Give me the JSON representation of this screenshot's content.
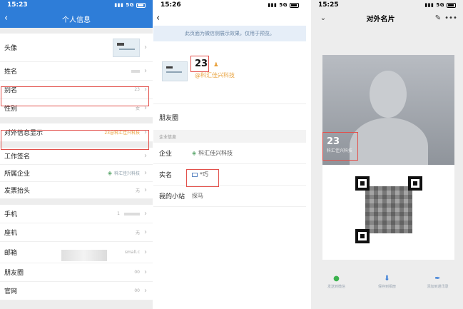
{
  "panel1": {
    "status": {
      "time": "15:23",
      "signal": "5G"
    },
    "nav": {
      "back_icon": "‹",
      "title": "个人信息"
    },
    "rows": {
      "avatar": {
        "label": "头像"
      },
      "name": {
        "label": "姓名",
        "value": ""
      },
      "alias": {
        "label": "别名",
        "value": "23"
      },
      "gender": {
        "label": "性别",
        "value": "女"
      },
      "external": {
        "label": "对外信息显示",
        "value": "23@科汇佳兴科技"
      },
      "job": {
        "label": "工作签名"
      },
      "corp": {
        "label": "所属企业",
        "value": "科汇佳兴科技"
      },
      "invoice": {
        "label": "发票抬头",
        "value": "无"
      },
      "mobile": {
        "label": "手机",
        "value": "1"
      },
      "phone": {
        "label": "座机",
        "value": "无"
      },
      "email": {
        "label": "邮箱",
        "value": "small.c"
      },
      "moments": {
        "label": "朋友圈",
        "value": "00"
      },
      "site": {
        "label": "官网",
        "value": "00"
      }
    }
  },
  "panel2": {
    "status": {
      "time": "15:26",
      "signal": "5G"
    },
    "back_icon": "‹",
    "notice": "此页面为微信侧展示效果，仅用于预览。",
    "name": "23",
    "corp_tag": "@科汇佳兴科技",
    "moments": "朋友圈",
    "section": "企业信息",
    "enterprise": {
      "label": "企业",
      "value": "科汇佳兴科技"
    },
    "realname": {
      "label": "实名",
      "value": "*巧"
    },
    "station": {
      "label": "我的小站",
      "value": "探马"
    }
  },
  "panel3": {
    "status": {
      "time": "15:25",
      "signal": "5G"
    },
    "title": "对外名片",
    "name": "23",
    "company": "科汇佳兴科技",
    "actions": [
      {
        "label": "发送到微信",
        "icon": "wechat-icon"
      },
      {
        "label": "保存到相册",
        "icon": "download-icon"
      },
      {
        "label": "添加到通讯录",
        "icon": "pen-icon"
      }
    ]
  },
  "colors": {
    "brand_blue": "#2e7dd8",
    "highlight_red": "#e2504b",
    "accent_orange": "#e8a03a"
  }
}
